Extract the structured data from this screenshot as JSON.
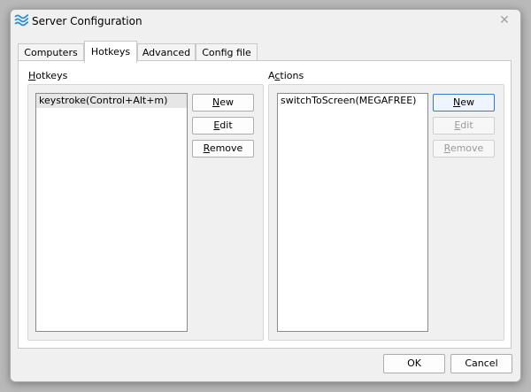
{
  "window": {
    "title": "Server Configuration",
    "app_icon": "wave-logo-icon",
    "close_icon": "close-icon"
  },
  "tabs": [
    {
      "label": "Computers"
    },
    {
      "label": "Hotkeys"
    },
    {
      "label": "Advanced"
    },
    {
      "label": "Config file"
    }
  ],
  "active_tab": "Hotkeys",
  "hotkeys": {
    "label_mnemonic": "H",
    "label_rest": "otkeys",
    "items": [
      "keystroke(Control+Alt+m)"
    ],
    "buttons": {
      "new": {
        "mn": "N",
        "rest": "ew"
      },
      "edit": {
        "mn": "E",
        "rest": "dit"
      },
      "remove": {
        "mn": "R",
        "rest": "emove"
      }
    }
  },
  "actions": {
    "label_first": "A",
    "label_mnemonic": "c",
    "label_rest": "tions",
    "items": [
      "switchToScreen(MEGAFREE)"
    ],
    "buttons": {
      "new": {
        "mn": "N",
        "rest": "ew"
      },
      "edit": {
        "mn": "E",
        "rest": "dit"
      },
      "remove": {
        "mn": "R",
        "rest": "emove"
      }
    }
  },
  "dialog_buttons": {
    "ok": "OK",
    "cancel": "Cancel"
  },
  "colors": {
    "logo": "#2b8fd8",
    "focus_border": "#2f7cd6"
  }
}
